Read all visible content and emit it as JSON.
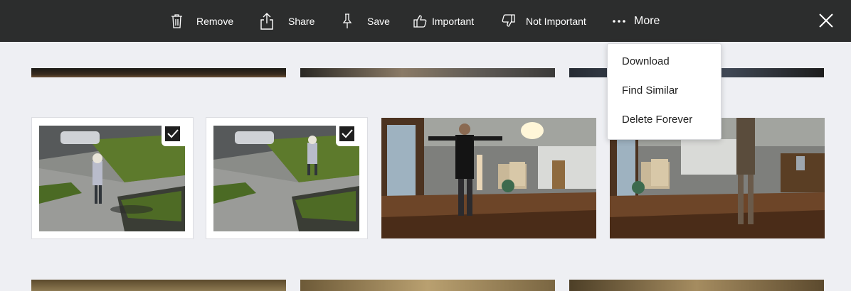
{
  "toolbar": {
    "remove_label": "Remove",
    "share_label": "Share",
    "save_label": "Save",
    "important_label": "Important",
    "not_important_label": "Not Important",
    "more_label": "More",
    "icons": {
      "remove": "trash-icon",
      "share": "share-icon",
      "save": "pin-icon",
      "important": "thumbs-up-icon",
      "not_important": "thumbs-down-icon",
      "more": "ellipsis-icon",
      "close": "close-icon"
    }
  },
  "more_menu": {
    "items": [
      "Download",
      "Find Similar",
      "Delete Forever"
    ]
  },
  "grid": {
    "rows": [
      {
        "thumbnails": 3,
        "state": "partially visible"
      },
      {
        "thumbnails": 4,
        "selected": [
          true,
          true,
          false,
          false
        ]
      },
      {
        "thumbnails": 3,
        "state": "partially visible"
      }
    ]
  },
  "colors": {
    "toolbar_bg": "#2c2d2d",
    "page_bg": "#eeeff3",
    "check_bg": "#1f1f1f"
  }
}
